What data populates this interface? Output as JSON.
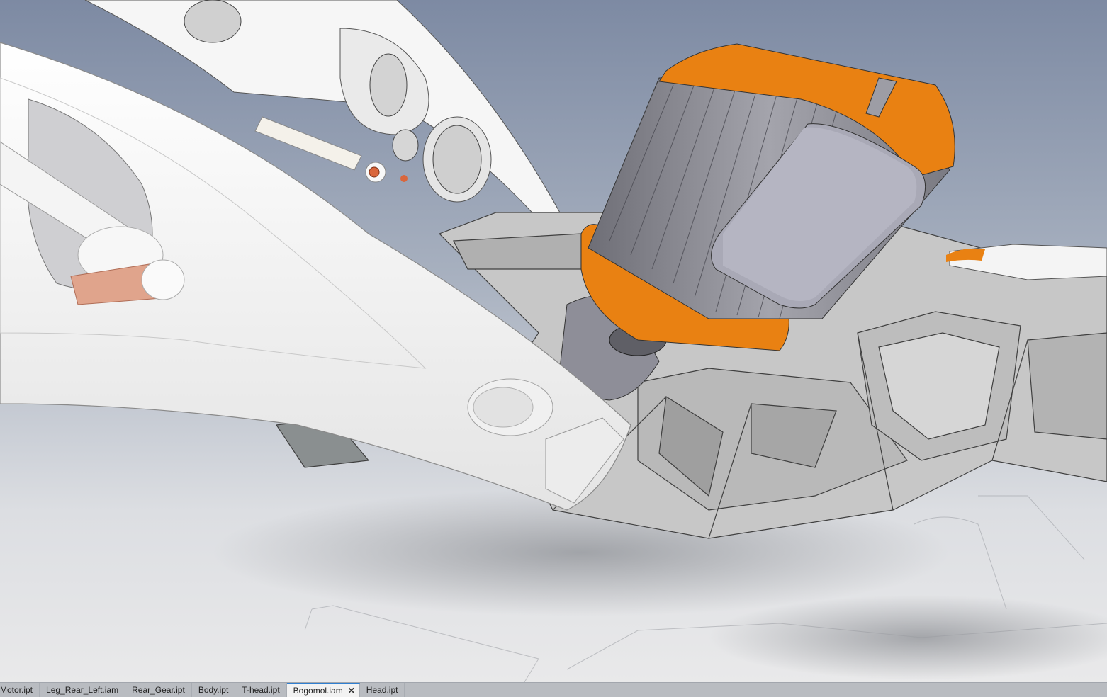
{
  "viewport": {
    "scene": "3D assembly model view",
    "colors": {
      "background_top": "#7d8aa3",
      "background_bottom": "#e9e9ea",
      "white_part": "#fafafa",
      "frame_gray": "#c7c7c7",
      "motor_orange": "#e98112",
      "motor_body": "#8c8c94",
      "copper_pin": "#e0a48c"
    }
  },
  "tabs": [
    {
      "label": "Motor.ipt",
      "active": false,
      "name": "tab-motor"
    },
    {
      "label": "Leg_Rear_Left.iam",
      "active": false,
      "name": "tab-leg-rear-left"
    },
    {
      "label": "Rear_Gear.ipt",
      "active": false,
      "name": "tab-rear-gear"
    },
    {
      "label": "Body.ipt",
      "active": false,
      "name": "tab-body"
    },
    {
      "label": "T-head.ipt",
      "active": false,
      "name": "tab-t-head"
    },
    {
      "label": "Bogomol.iam",
      "active": true,
      "name": "tab-bogomol"
    },
    {
      "label": "Head.ipt",
      "active": false,
      "name": "tab-head"
    }
  ],
  "close_icon": "close-icon"
}
